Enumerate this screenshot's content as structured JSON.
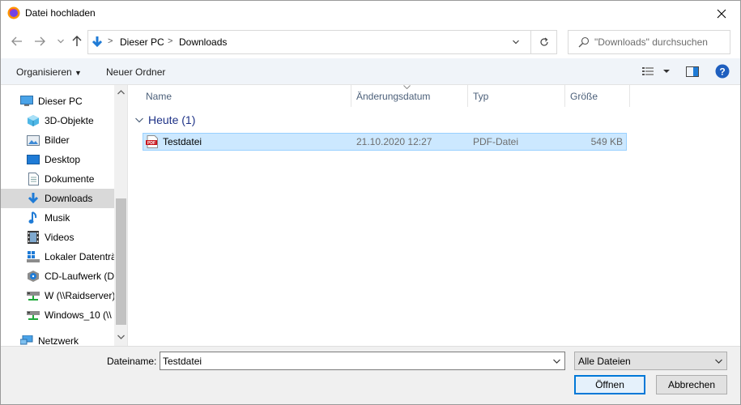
{
  "window": {
    "title": "Datei hochladen"
  },
  "nav": {
    "breadcrumb": [
      "Dieser PC",
      "Downloads"
    ],
    "search_placeholder": "\"Downloads\" durchsuchen"
  },
  "toolbar": {
    "organize": "Organisieren",
    "new_folder": "Neuer Ordner"
  },
  "sidebar": {
    "items": [
      {
        "label": "Dieser PC",
        "icon": "pc-icon"
      },
      {
        "label": "3D-Objekte",
        "icon": "cube-icon"
      },
      {
        "label": "Bilder",
        "icon": "pictures-icon"
      },
      {
        "label": "Desktop",
        "icon": "desktop-icon"
      },
      {
        "label": "Dokumente",
        "icon": "documents-icon"
      },
      {
        "label": "Downloads",
        "icon": "download-icon",
        "selected": true
      },
      {
        "label": "Musik",
        "icon": "music-icon"
      },
      {
        "label": "Videos",
        "icon": "videos-icon"
      },
      {
        "label": "Lokaler Datenträ",
        "icon": "drive-icon"
      },
      {
        "label": "CD-Laufwerk (D:",
        "icon": "cd-icon"
      },
      {
        "label": "W (\\\\Raidserver)",
        "icon": "network-drive-icon"
      },
      {
        "label": "Windows_10 (\\\\",
        "icon": "network-drive-icon"
      },
      {
        "label": "Netzwerk",
        "icon": "network-icon"
      }
    ]
  },
  "filelist": {
    "columns": [
      "Name",
      "Änderungsdatum",
      "Typ",
      "Größe"
    ],
    "group": "Heute (1)",
    "rows": [
      {
        "name": "Testdatei",
        "date": "21.10.2020 12:27",
        "type": "PDF-Datei",
        "size": "549 KB",
        "icon": "pdf-icon",
        "icon_text": "PDF"
      }
    ]
  },
  "bottom": {
    "filename_label": "Dateiname:",
    "filename_value": "Testdatei",
    "filetype": "Alle Dateien",
    "open": "Öffnen",
    "cancel": "Abbrechen"
  },
  "colors": {
    "accent": "#0078d7",
    "selection": "#cce8ff",
    "group_header": "#1e3287"
  }
}
